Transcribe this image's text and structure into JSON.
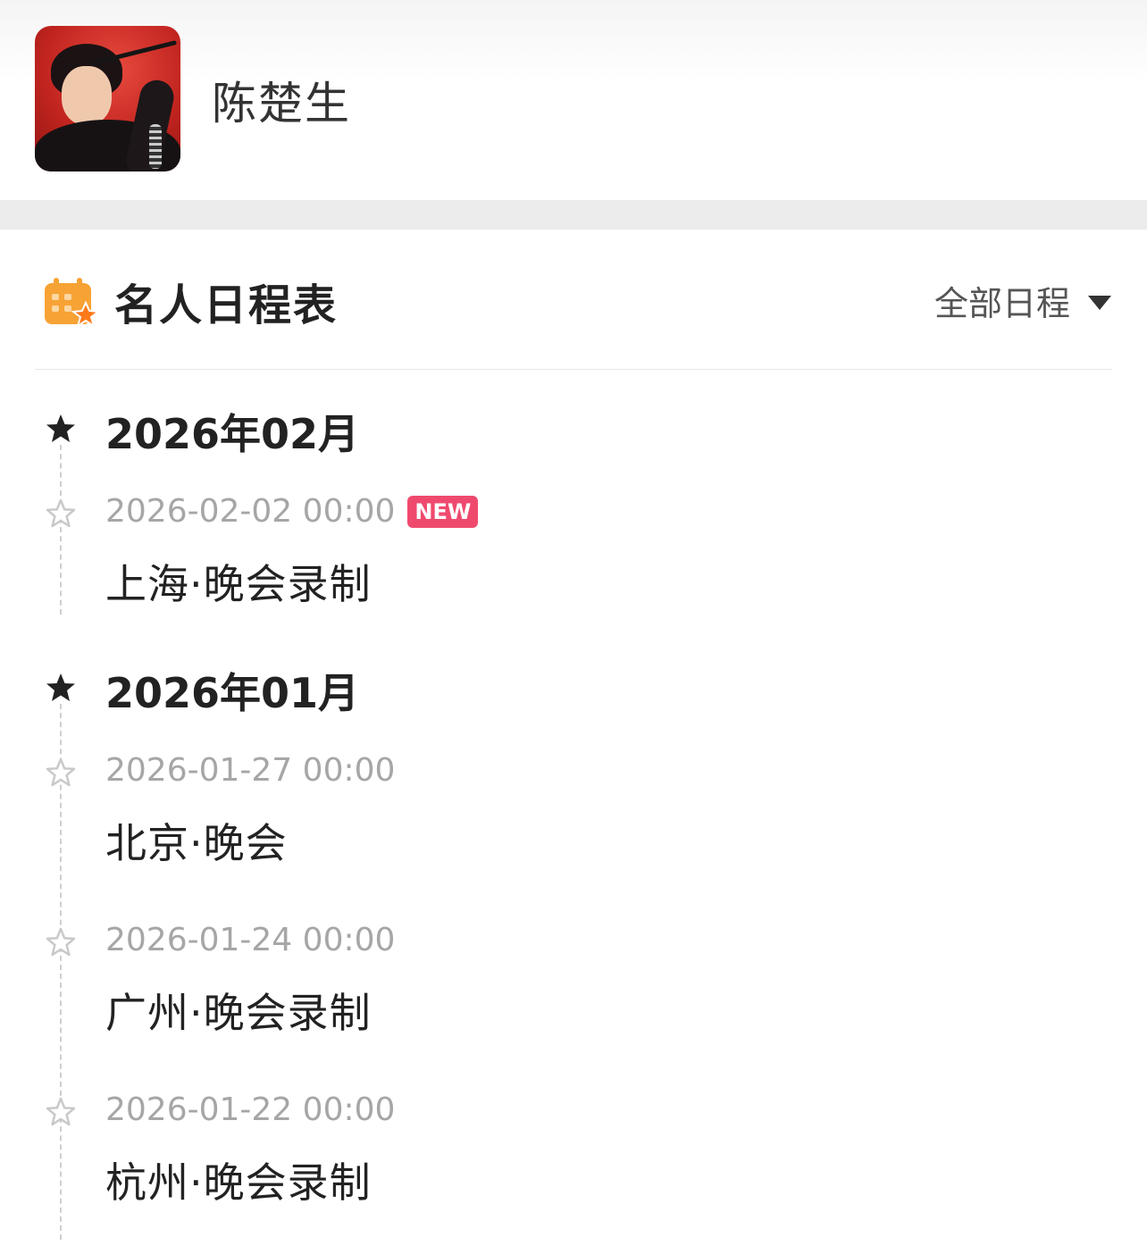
{
  "profile": {
    "name": "陈楚生"
  },
  "schedule": {
    "title": "名人日程表",
    "filter_label": "全部日程",
    "accent_color": "#f5a623",
    "new_badge_color": "#ef4a6e",
    "months": [
      {
        "label": "2026年02月",
        "items": [
          {
            "date": "2026-02-02 00:00",
            "badge": "NEW",
            "title": "上海·晚会录制"
          }
        ]
      },
      {
        "label": "2026年01月",
        "items": [
          {
            "date": "2026-01-27 00:00",
            "title": "北京·晚会"
          },
          {
            "date": "2026-01-24 00:00",
            "title": "广州·晚会录制"
          },
          {
            "date": "2026-01-22 00:00",
            "title": "杭州·晚会录制"
          }
        ]
      }
    ]
  }
}
